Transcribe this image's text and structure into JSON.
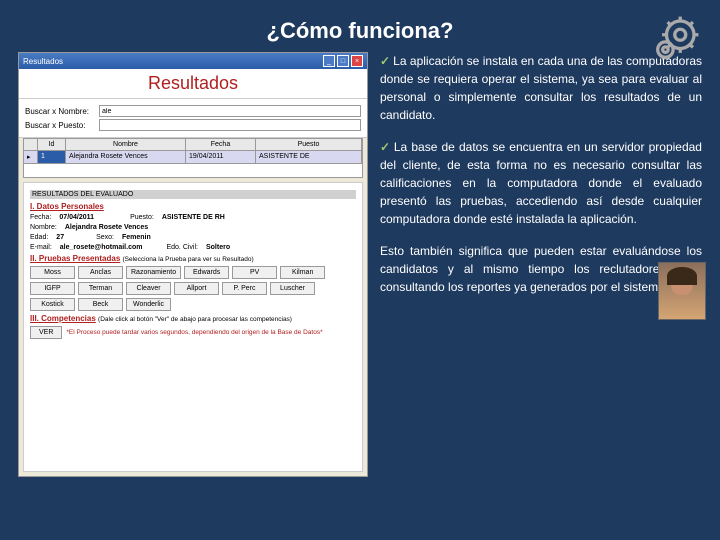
{
  "slide": {
    "title": "¿Cómo funciona?"
  },
  "win": {
    "title": "Resultados",
    "heading": "Resultados",
    "search_name_lbl": "Buscar x Nombre:",
    "search_puesto_lbl": "Buscar x Puesto:",
    "search_val": "ale"
  },
  "grid": {
    "h_id": "Id",
    "h_nombre": "Nombre",
    "h_fecha": "Fecha",
    "h_puesto": "Puesto",
    "r1_id": "1",
    "r1_nombre": "Alejandra Rosete Vences",
    "r1_fecha": "19/04/2011",
    "r1_puesto": "ASISTENTE DE"
  },
  "detail": {
    "hdr": "RESULTADOS DEL EVALUADO",
    "s1": "I. Datos Personales",
    "fecha_l": "Fecha:",
    "fecha_v": "07/04/2011",
    "puesto_l": "Puesto:",
    "puesto_v": "ASISTENTE DE RH",
    "nombre_l": "Nombre:",
    "nombre_v": "Alejandra Rosete Vences",
    "edad_l": "Edad:",
    "edad_v": "27",
    "sexo_l": "Sexo:",
    "sexo_v": "Femenin",
    "email_l": "E-mail:",
    "email_v": "ale_rosete@hotmail.com",
    "edo_l": "Edo. Civil:",
    "edo_v": "Soltero",
    "s2": "II. Pruebas Presentadas",
    "s2_note": "(Selecciona la Prueba para ver su Resultado)",
    "s3": "III. Competencias",
    "s3_note": "(Dale click al botón \"Ver\" de abajo para procesar las competencias)",
    "ver": "VER",
    "footnote": "*El Proceso puede tardar varios segundos, dependiendo del origen de la Base de Datos*"
  },
  "tests": [
    "Moss",
    "Anclas",
    "Razonamiento",
    "Edwards",
    "PV",
    "Kilman",
    "IGFP",
    "Terman",
    "Cleaver",
    "Allport",
    "P. Perc",
    "Luscher",
    "Kostick",
    "Beck",
    "Wonderlic"
  ],
  "bullets": {
    "b1": "La aplicación se instala en cada una de las computadoras donde se requiera operar el sistema, ya sea para evaluar al personal o simplemente consultar los resultados de un candidato.",
    "b2": "La base de datos se encuentra en un servidor propiedad del cliente, de esta forma no es necesario consultar las calificaciones en la computadora donde el evaluado presentó las pruebas, accediendo así desde cualquier computadora donde esté instalada la aplicación.",
    "b3": "Esto también significa que pueden estar evaluándose los candidatos y al mismo tiempo los reclutadores estar consultando los reportes ya generados por el sistema"
  }
}
